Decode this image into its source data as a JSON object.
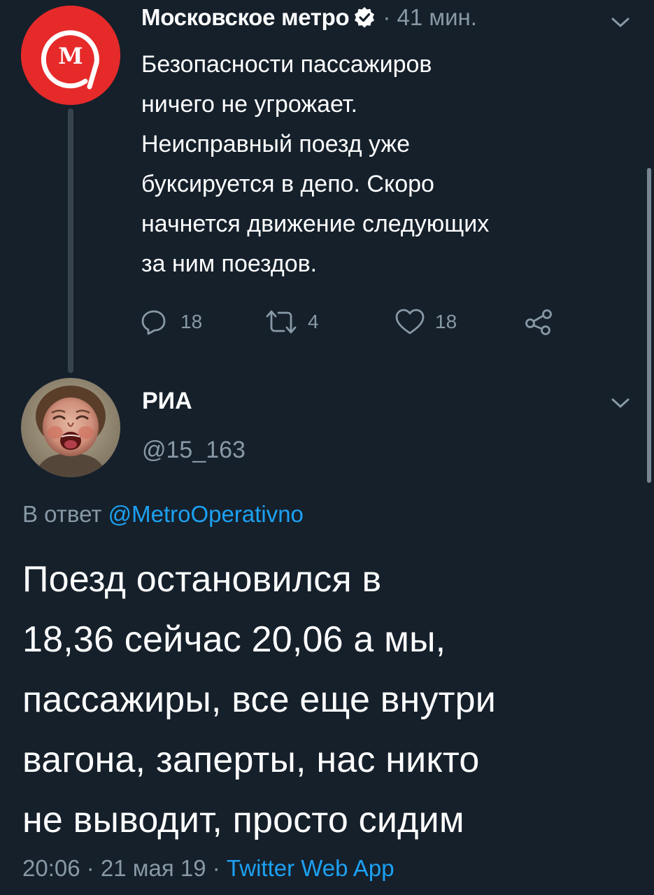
{
  "colors": {
    "background": "#15202b",
    "text_primary": "#ffffff",
    "text_secondary": "#8899a6",
    "link": "#1da1f2",
    "metro_red": "#e62a2a",
    "thread_line": "#38444d"
  },
  "parent_tweet": {
    "avatar_icon": "moscow-metro-logo",
    "avatar_letter": "М",
    "author_name": "Московское метро",
    "verified_icon": "verified-badge-icon",
    "time_ago": "· 41 мин.",
    "text": "Безопасности пассажиров\nничего не угрожает.\nНеисправный поезд уже\nбуксируется в депо. Скоро\nначнется движение следующих\nза ним поездов.",
    "actions": {
      "reply_count": "18",
      "retweet_count": "4",
      "like_count": "18"
    }
  },
  "main_tweet": {
    "avatar_icon": "screaming-child-portrait",
    "author_name": "РИА",
    "handle": "@15_163",
    "reply_prefix": "В ответ ",
    "reply_to": "@MetroOperativno",
    "text": "Поезд остановился в\n18,36 сейчас 20,06 а мы,\nпассажиры, все еще внутри\nвагона, заперты, нас никто\nне выводит, просто сидим",
    "time": "20:06",
    "date": " · 21 мая 19 · ",
    "source": "Twitter Web App"
  }
}
